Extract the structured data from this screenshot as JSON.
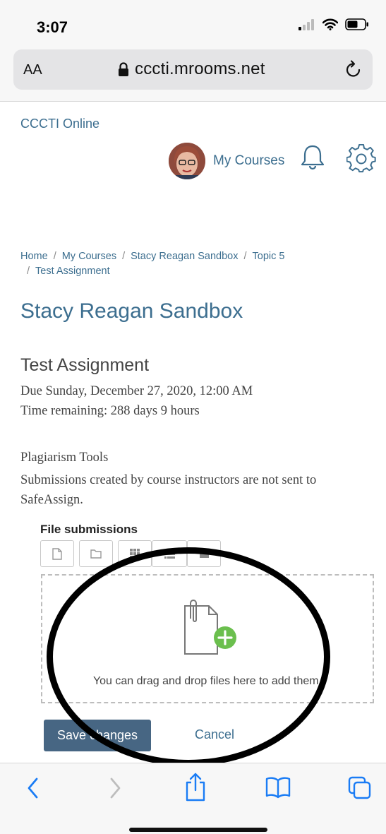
{
  "status_bar": {
    "time": "3:07"
  },
  "browser": {
    "text_size_label": "AA",
    "url": "cccti.mrooms.net"
  },
  "header": {
    "site_name": "CCCTI Online",
    "my_courses": "My Courses"
  },
  "breadcrumb": {
    "items": [
      "Home",
      "My Courses",
      "Stacy Reagan Sandbox",
      "Topic 5",
      "Test Assignment"
    ]
  },
  "course": {
    "title": "Stacy Reagan Sandbox"
  },
  "assignment": {
    "title": "Test Assignment",
    "due": "Due Sunday, December 27, 2020, 12:00 AM",
    "time_remaining": "Time remaining: 288 days 9 hours"
  },
  "plagiarism": {
    "title": "Plagiarism Tools",
    "text": "Submissions created by course instructors are not sent to SafeAssign."
  },
  "file_submissions": {
    "label": "File submissions",
    "drop_text": "You can drag and drop files here to add them."
  },
  "actions": {
    "save_label": "Save changes",
    "cancel_label": "Cancel"
  },
  "colors": {
    "link": "#3c6e8f",
    "primary_button": "#476683",
    "add_badge": "#6bbf4e",
    "ios_blue": "#1a7cf5"
  }
}
